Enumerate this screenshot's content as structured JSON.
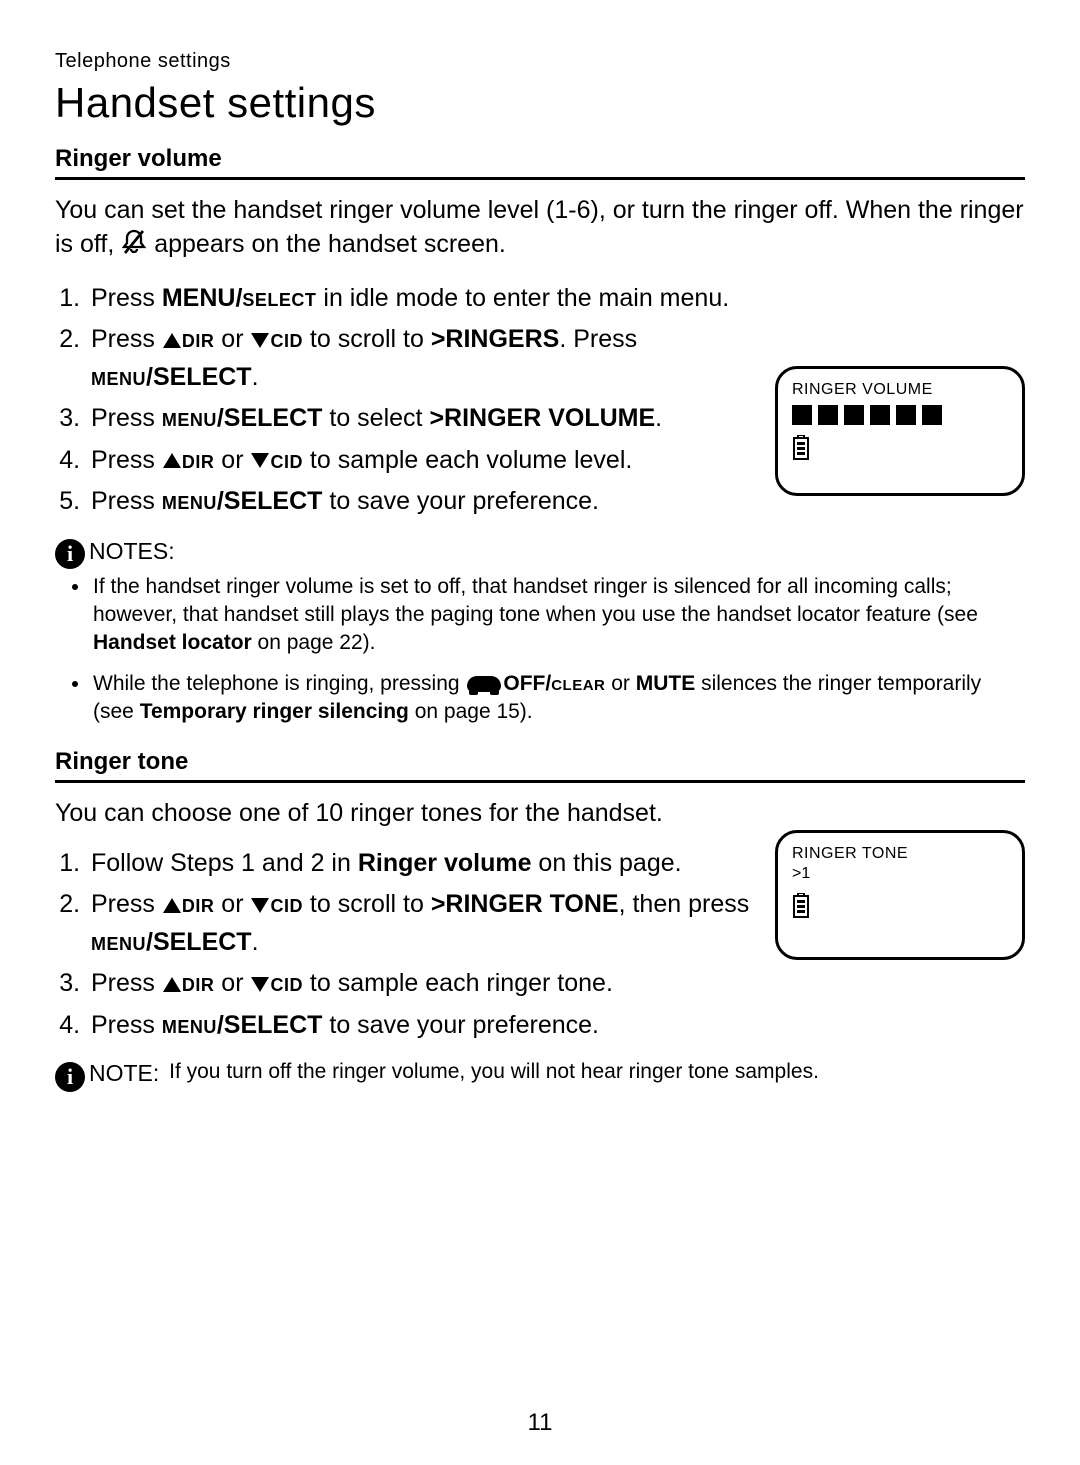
{
  "header": {
    "eyebrow": "Telephone settings",
    "title": "Handset settings"
  },
  "ringer_volume": {
    "heading": "Ringer volume",
    "intro_parts": {
      "a": "You can set the handset ringer volume level (1-6), or turn the ringer off. When the ringer is off, ",
      "b": " appears on the handset screen."
    },
    "steps": {
      "s1": {
        "a": "Press ",
        "menu_bold": "MENU/",
        "select_sc": "select",
        "b": " in idle mode to enter the main menu."
      },
      "s2": {
        "a": "Press ",
        "dir": "dir",
        "or": " or ",
        "cid": "cid",
        "b": " to scroll to ",
        "target": ">RINGERS",
        "c": ". Press ",
        "menu_sc": "menu",
        "select_bold": "/SELECT",
        "d": "."
      },
      "s3": {
        "a": "Press ",
        "menu_sc": "menu",
        "select_bold": "/SELECT",
        "b": " to select ",
        "target": ">RINGER VOLUME",
        "c": "."
      },
      "s4": {
        "a": "Press ",
        "dir": "dir",
        "or": " or ",
        "cid": "cid",
        "b": " to sample each volume level."
      },
      "s5": {
        "a": "Press ",
        "menu_sc": "menu",
        "select_bold": "/SELECT",
        "b": " to save your preference."
      }
    },
    "notes_label": "NOTES:",
    "notes": {
      "n1": {
        "a": "If the handset ringer volume is set to off, that handset ringer is silenced for all incoming calls; however, that handset still plays the paging tone when you use the handset locator feature (see ",
        "link": "Handset locator",
        "b": " on page 22)."
      },
      "n2": {
        "a": "While the telephone is ringing, pressing ",
        "off_bold": "OFF/",
        "clear_sc": "clear",
        "or": " or ",
        "mute": "MUTE",
        "b": " silences the ringer temporarily (see ",
        "link": "Temporary ringer silencing",
        "c": " on page 15)."
      }
    },
    "screen": {
      "title": "RINGER VOLUME"
    }
  },
  "ringer_tone": {
    "heading": "Ringer tone",
    "intro": "You can choose one of 10 ringer tones for the handset.",
    "steps": {
      "s1": {
        "a": "Follow Steps 1 and 2 in ",
        "link": "Ringer volume",
        "b": " on this page."
      },
      "s2": {
        "a": "Press ",
        "dir": "dir",
        "or": " or ",
        "cid": "cid",
        "b": " to scroll to ",
        "target": ">RINGER TONE",
        "c": ", then press ",
        "menu_sc": "menu",
        "select_bold": "/SELECT",
        "d": "."
      },
      "s3": {
        "a": "Press ",
        "dir": "dir",
        "or": " or ",
        "cid": "cid",
        "b": " to sample each ringer tone."
      },
      "s4": {
        "a": "Press ",
        "menu_sc": "menu",
        "select_bold": "/SELECT",
        "b": " to save your preference."
      }
    },
    "note": {
      "lead": "NOTE:",
      "text": "If you turn off the ringer volume, you will not hear ringer tone samples."
    },
    "screen": {
      "title": "RINGER TONE",
      "sub": ">1"
    }
  },
  "page_number": "11",
  "icons": {
    "info": "i"
  }
}
